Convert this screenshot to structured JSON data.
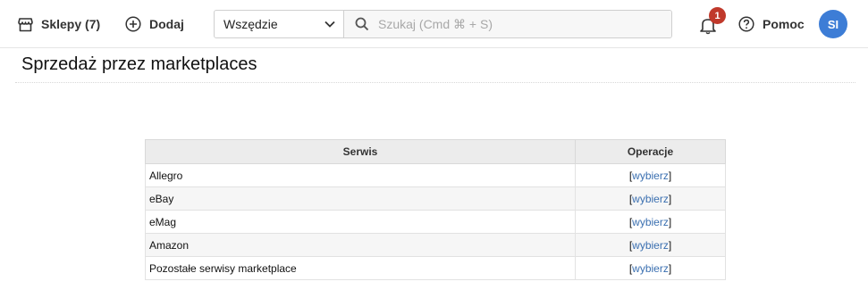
{
  "topbar": {
    "shops_label": "Sklepy (7)",
    "add_label": "Dodaj",
    "search_scope": "Wszędzie",
    "search_placeholder": "Szukaj (Cmd ⌘ + S)",
    "notifications_count": "1",
    "help_label": "Pomoc",
    "avatar_initials": "SI"
  },
  "page": {
    "title": "Sprzedaż przez marketplaces"
  },
  "table": {
    "headers": [
      "Serwis",
      "Operacje"
    ],
    "rows": [
      {
        "service": "Allegro",
        "bracket_open": "[",
        "action": "wybierz",
        "bracket_close": "]"
      },
      {
        "service": "eBay",
        "bracket_open": "[",
        "action": "wybierz",
        "bracket_close": "]"
      },
      {
        "service": "eMag",
        "bracket_open": "[",
        "action": "wybierz",
        "bracket_close": "]"
      },
      {
        "service": "Amazon",
        "bracket_open": "[",
        "action": "wybierz",
        "bracket_close": "]"
      },
      {
        "service": "Pozostałe serwisy marketplace",
        "bracket_open": "[",
        "action": "wybierz",
        "bracket_close": "]"
      }
    ]
  },
  "colors": {
    "badge": "#c0392b",
    "avatar": "#3d7dd6",
    "link": "#3a6fb0"
  }
}
